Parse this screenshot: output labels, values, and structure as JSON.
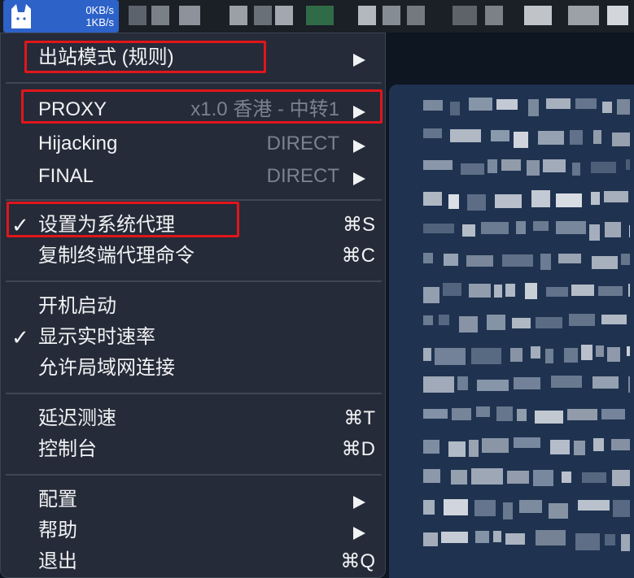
{
  "menubar": {
    "app_icon": "cat-icon",
    "upload_speed": "0KB/s",
    "download_speed": "1KB/s"
  },
  "menu": {
    "outbound_mode": {
      "label": "出站模式 (规则)"
    },
    "proxy": {
      "label": "PROXY",
      "value": "x1.0 香港 - 中转1"
    },
    "hijacking": {
      "label": "Hijacking",
      "value": "DIRECT"
    },
    "final": {
      "label": "FINAL",
      "value": "DIRECT"
    },
    "set_system_proxy": {
      "label": "设置为系统代理",
      "shortcut": "⌘S",
      "checked": true
    },
    "copy_terminal_cmd": {
      "label": "复制终端代理命令",
      "shortcut": "⌘C"
    },
    "launch_at_login": {
      "label": "开机启动"
    },
    "show_speed": {
      "label": "显示实时速率",
      "checked": true
    },
    "allow_lan": {
      "label": "允许局域网连接"
    },
    "latency_test": {
      "label": "延迟测速",
      "shortcut": "⌘T"
    },
    "console": {
      "label": "控制台",
      "shortcut": "⌘D"
    },
    "config": {
      "label": "配置"
    },
    "help": {
      "label": "帮助"
    },
    "quit": {
      "label": "退出",
      "shortcut": "⌘Q"
    }
  },
  "checkmark_glyph": "✓",
  "highlight_color": "#e0161b"
}
